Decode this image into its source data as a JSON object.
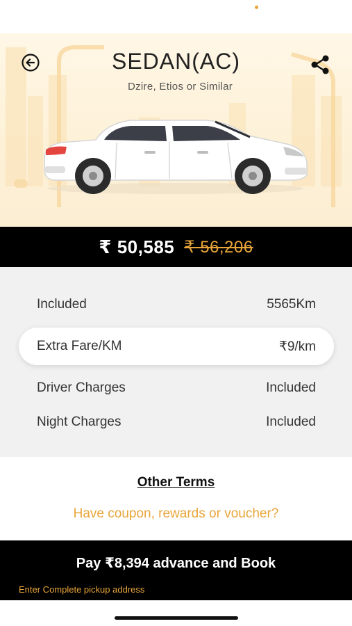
{
  "header": {
    "title": "SEDAN(AC)",
    "subtitle": "Dzire, Etios or Similar"
  },
  "icons": {
    "back": "back-arrow-circle-icon",
    "share": "share-icon",
    "car": "sedan-car-illustration"
  },
  "price": {
    "current": "₹ 50,585",
    "original": "₹ 56,206"
  },
  "details": [
    {
      "label": "Included",
      "value": "5565Km"
    },
    {
      "label": "Extra Fare/KM",
      "value": "₹9/km"
    },
    {
      "label": "Driver Charges",
      "value": "Included"
    },
    {
      "label": "Night Charges",
      "value": "Included"
    }
  ],
  "links": {
    "other_terms": "Other Terms",
    "coupon": "Have coupon, rewards or voucher?"
  },
  "footer": {
    "book_label": "Pay ₹8,394 advance and Book",
    "address_hint": "Enter Complete pickup address"
  },
  "colors": {
    "accent": "#e8a53a",
    "dark": "#000000",
    "panel": "#f1f1f1"
  }
}
